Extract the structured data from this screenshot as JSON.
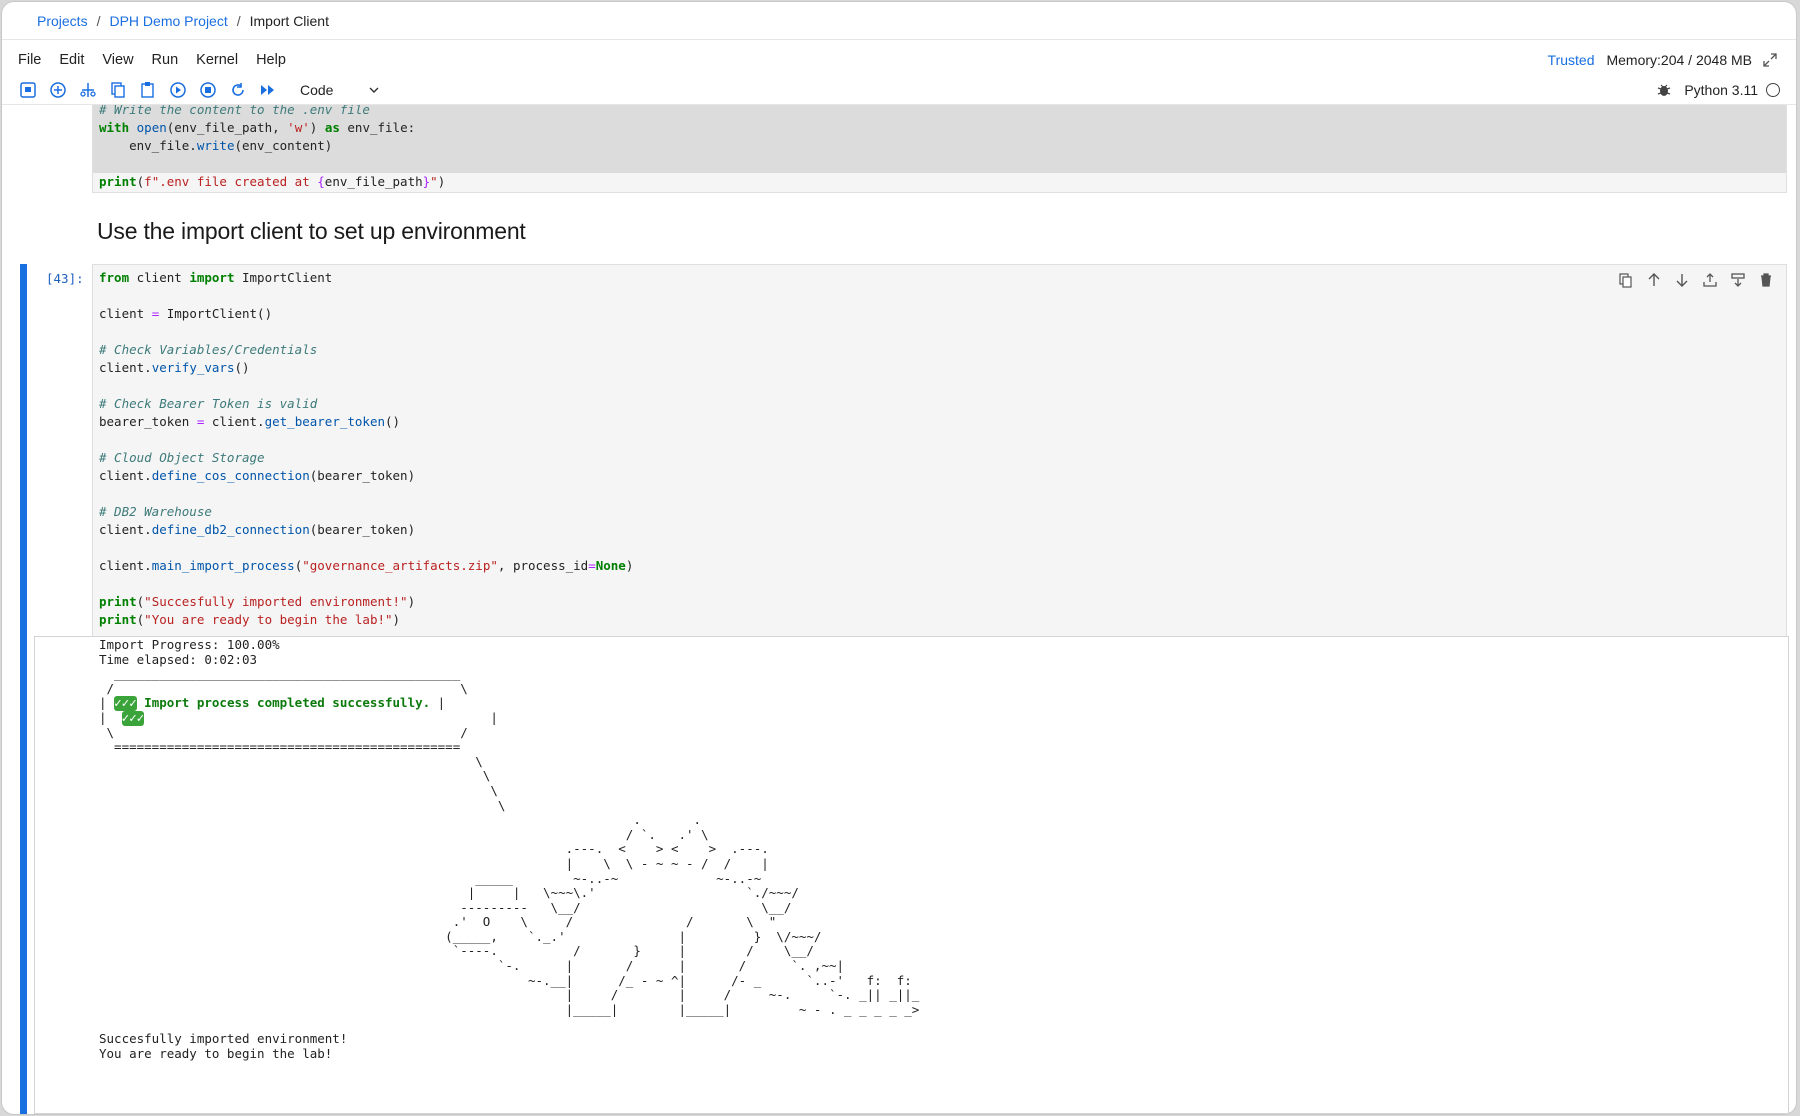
{
  "breadcrumb": {
    "items": [
      "Projects",
      "DPH Demo Project"
    ],
    "current": "Import Client",
    "separator": "/"
  },
  "menu": {
    "items": [
      "File",
      "Edit",
      "View",
      "Run",
      "Kernel",
      "Help"
    ],
    "trusted": "Trusted",
    "memory": "Memory:204 / 2048 MB"
  },
  "toolbar": {
    "buttons": [
      "save-icon",
      "add-cell-icon",
      "cut-icon",
      "copy-icon",
      "paste-icon",
      "run-icon",
      "stop-icon",
      "restart-icon",
      "run-all-icon"
    ],
    "cell_type": "Code",
    "kernel_name": "Python 3.11"
  },
  "prev_cell": {
    "lines": [
      "# Write the content to the .env file",
      "with open(env_file_path, 'w') as env_file:",
      "    env_file.write(env_content)",
      "",
      "print(f\".env file created at {env_file_path}\")"
    ]
  },
  "markdown": {
    "heading": "Use the import client to set up environment"
  },
  "code_cell": {
    "prompt": "[43]:",
    "lines": [
      "from client import ImportClient",
      "",
      "client = ImportClient()",
      "",
      "# Check Variables/Credentials",
      "client.verify_vars()",
      "",
      "# Check Bearer Token is valid",
      "bearer_token = client.get_bearer_token()",
      "",
      "# Cloud Object Storage",
      "client.define_cos_connection(bearer_token)",
      "",
      "# DB2 Warehouse",
      "client.define_db2_connection(bearer_token)",
      "",
      "client.main_import_process(\"governance_artifacts.zip\", process_id=None)",
      "",
      "print(\"Succesfully imported environment!\")",
      "print(\"You are ready to begin the lab!\")"
    ]
  },
  "output": {
    "progress": "Import Progress: 100.00%",
    "elapsed": "Time elapsed: 0:02:03",
    "art_top": "  ______________________________________________\n /                                              \\",
    "check_marks": "✓✓✓",
    "message": " Import process completed successfully. ",
    "art_mid_left": "|  ",
    "art_bottom": " \\                                              /\n  ==============================================\n                                                  \\\n                                                   \\\n                                                    \\\n                                                     \\\n                                                                       .       .\n                                                                      / `.   .' \\\n                                                              .---.  <    > <    >  .---.\n                                                              |    \\  \\ - ~ ~ - /  /    |\n                                                  _____        ~-..-~             ~-..-~\n                                                 |     |   \\~~~\\.'                    `./~~~/\n                                                ---------   \\__/                        \\__/\n                                               .'  O    \\     /               /       \\  \"\n                                              (_____,    `._.'               |         }  \\/~~~/\n                                               `----.          /       }     |        /    \\__/\n                                                     `-.      |       /      |       /      `. ,~~|\n                                                         ~-.__|      /_ - ~ ^|      /- _      `..-'   f:  f:\n                                                              |     /        |     /     ~-.     `-. _|| _||_\n                                                              |_____|        |_____|         ~ - . _ _ _ _ _>",
    "done": "Succesfully imported environment!",
    "ready": "You are ready to begin the lab!"
  },
  "colors": {
    "accent": "#1a6fe0",
    "keyword": "#008000",
    "comment": "#3d7a7a",
    "string": "#ba2121"
  }
}
